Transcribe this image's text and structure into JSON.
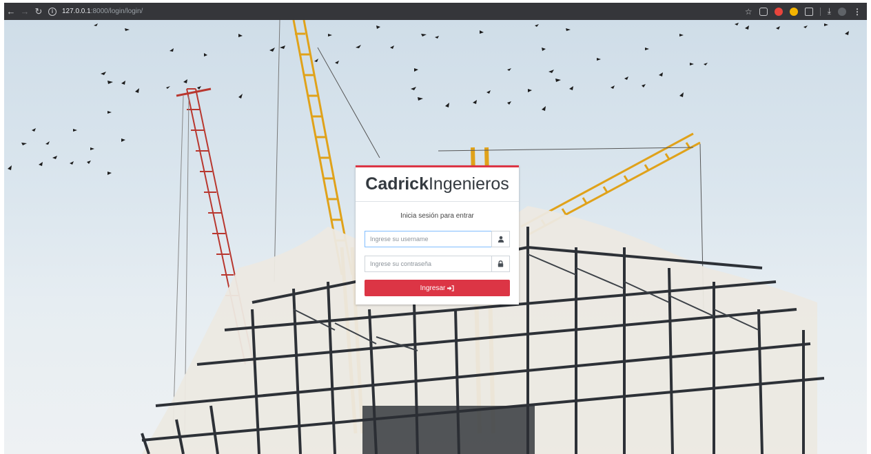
{
  "browser": {
    "url_host": "127.0.0.1",
    "url_path": ":8000/login/login/",
    "ext_colors": [
      "#3c4043",
      "#e8453c",
      "#f4b400",
      "#9aa0a6"
    ]
  },
  "login": {
    "brand_bold": "Cadrick",
    "brand_light": "Ingenieros",
    "subtitle": "Inicia sesión para entrar",
    "username_placeholder": "Ingrese su username",
    "password_placeholder": "Ingrese su contraseña",
    "submit_label": "Ingresar",
    "accent_color": "#dc3545"
  }
}
